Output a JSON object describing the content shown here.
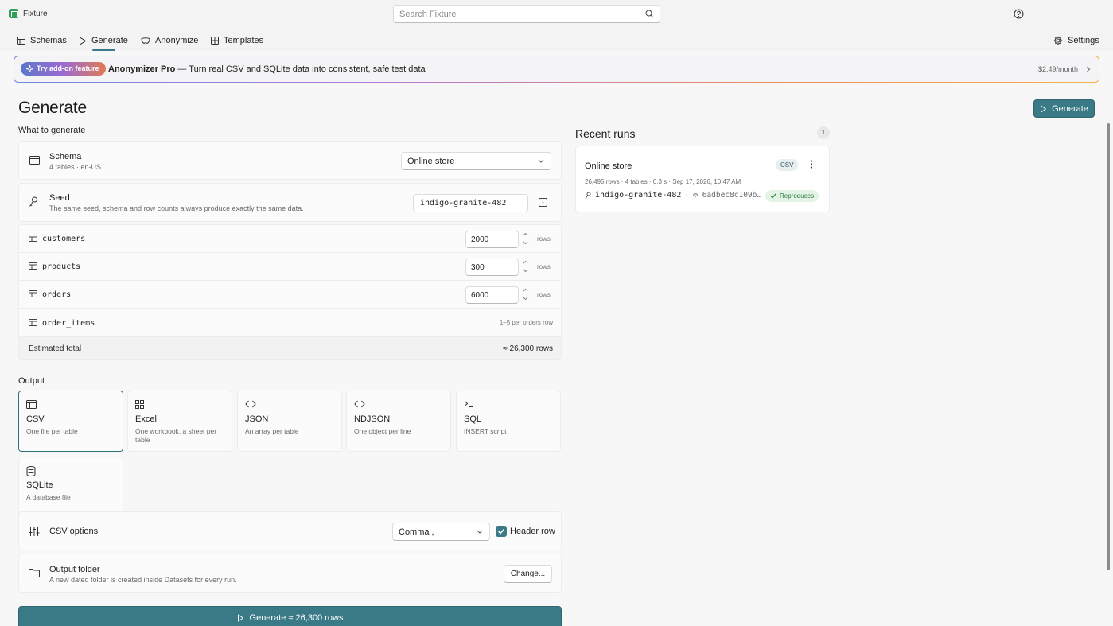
{
  "app": {
    "name": "Fixture"
  },
  "search": {
    "placeholder": "Search Fixture"
  },
  "nav": {
    "schemas": "Schemas",
    "generate": "Generate",
    "anonymize": "Anonymize",
    "templates": "Templates",
    "settings": "Settings"
  },
  "banner": {
    "pill": "Try add-on feature",
    "product": "Anonymizer Pro",
    "text": " — Turn real CSV and SQLite data into consistent, safe test data",
    "price": "$2.49/month"
  },
  "page": {
    "title": "Generate",
    "generate_button": "Generate"
  },
  "what": {
    "label": "What to generate",
    "schema_title": "Schema",
    "schema_sub": "4 tables · en-US",
    "schema_value": "Online store",
    "seed_title": "Seed",
    "seed_sub": "The same seed, schema and row counts always produce exactly the same data.",
    "seed_value": "indigo-granite-482"
  },
  "tables": [
    {
      "name": "customers",
      "rows": "2000",
      "unit": "rows"
    },
    {
      "name": "products",
      "rows": "300",
      "unit": "rows"
    },
    {
      "name": "orders",
      "rows": "6000",
      "unit": "rows"
    },
    {
      "name": "order_items",
      "note": "1–5 per orders row"
    }
  ],
  "total": {
    "label": "Estimated total",
    "value": "≈ 26,300 rows"
  },
  "output": {
    "label": "Output",
    "formats": [
      {
        "name": "CSV",
        "desc": "One file per table",
        "icon": "table-icon"
      },
      {
        "name": "Excel",
        "desc": "One workbook, a sheet per table",
        "icon": "grid-icon"
      },
      {
        "name": "JSON",
        "desc": "An array per table",
        "icon": "code-icon"
      },
      {
        "name": "NDJSON",
        "desc": "One object per line",
        "icon": "code-icon"
      },
      {
        "name": "SQL",
        "desc": "INSERT script",
        "icon": "terminal-icon"
      },
      {
        "name": "SQLite",
        "desc": "A database file",
        "icon": "database-icon"
      }
    ],
    "csv_options_label": "CSV options",
    "delimiter": "Comma ,",
    "header_row": "Header row",
    "folder_title": "Output folder",
    "folder_sub": "A new dated folder is created inside Datasets for every run.",
    "change_button": "Change..."
  },
  "main_button": "Generate ≈ 26,300 rows",
  "recent": {
    "title": "Recent runs",
    "count": "1",
    "runs": [
      {
        "name": "Online store",
        "format": "CSV",
        "meta": "26,495 rows · 4 tables · 0.3 s · Sep 17, 2026, 10:47 AM",
        "seed": "indigo-granite-482",
        "hash": "6adbec8c109b…",
        "status": "Reproduces"
      }
    ]
  },
  "colors": {
    "accent": "#3a7a86",
    "success": "#2a7a3b"
  }
}
